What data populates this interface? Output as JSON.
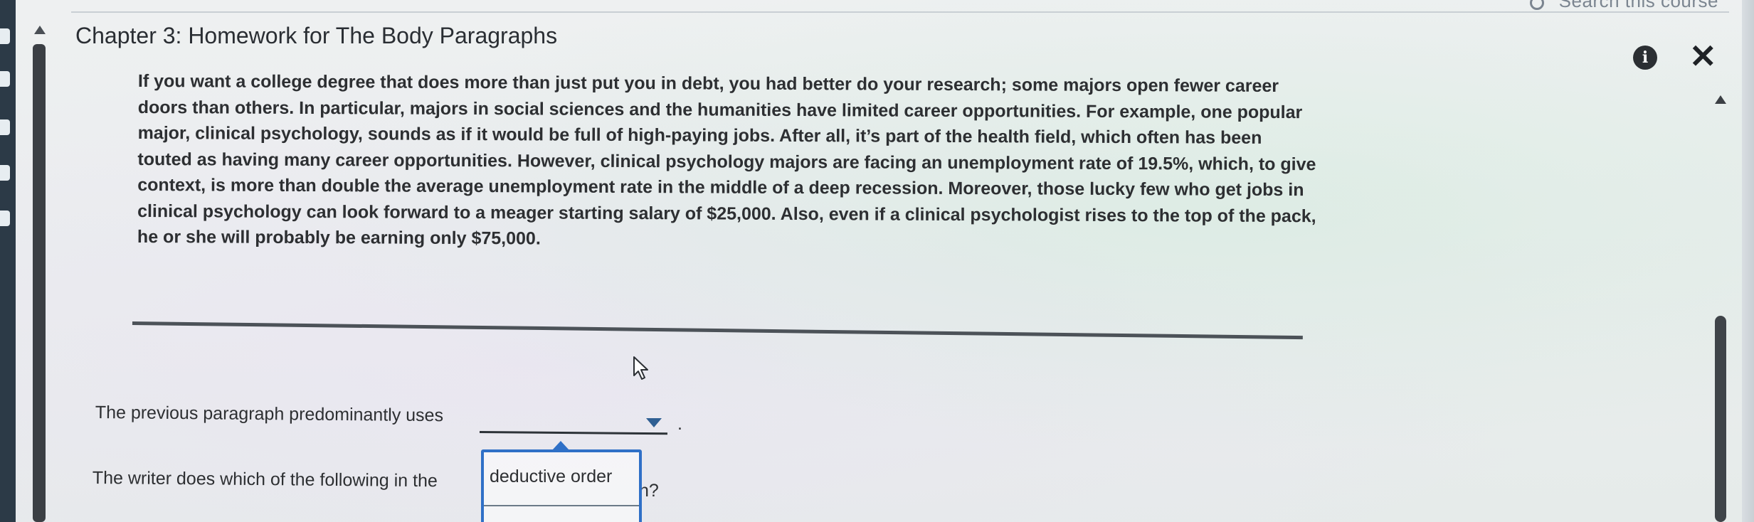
{
  "header": {
    "chapter_title": "Chapter 3: Homework for The Body Paragraphs",
    "search_text": "Search this course"
  },
  "paragraph": {
    "text": "If you want a college degree that does more than just put you in debt, you had better do your research; some majors open fewer career doors than others. In particular, majors in social sciences and the humanities have limited career opportunities. For example, one popular major, clinical psychology, sounds as if it would be full of high-paying jobs. After all, it’s part of the health field, which often has been touted as having many career opportunities. However, clinical psychology majors are facing an unemployment rate of 19.5%, which, to give context, is more than double the average unemployment rate in the middle of a deep recession. Moreover, those lucky few who get jobs in clinical psychology can look forward to a meager starting salary of $25,000. Also, even if a clinical psychologist rises to the top of the pack, he or she will probably be earning only $75,000."
  },
  "question1": {
    "label": "The previous paragraph predominantly uses",
    "suffix": "."
  },
  "question2": {
    "label_start": "The writer does which of the following in the",
    "label_end": "h?"
  },
  "dropdown": {
    "options": [
      "deductive order"
    ]
  },
  "icons": {
    "info": "info-icon",
    "close": "close-icon",
    "cursor": "mouse-cursor-icon",
    "search": "search-icon"
  },
  "colors": {
    "accent": "#2f70c7",
    "dropdown_arrow": "#2f5f93",
    "text": "#2d2f32"
  }
}
